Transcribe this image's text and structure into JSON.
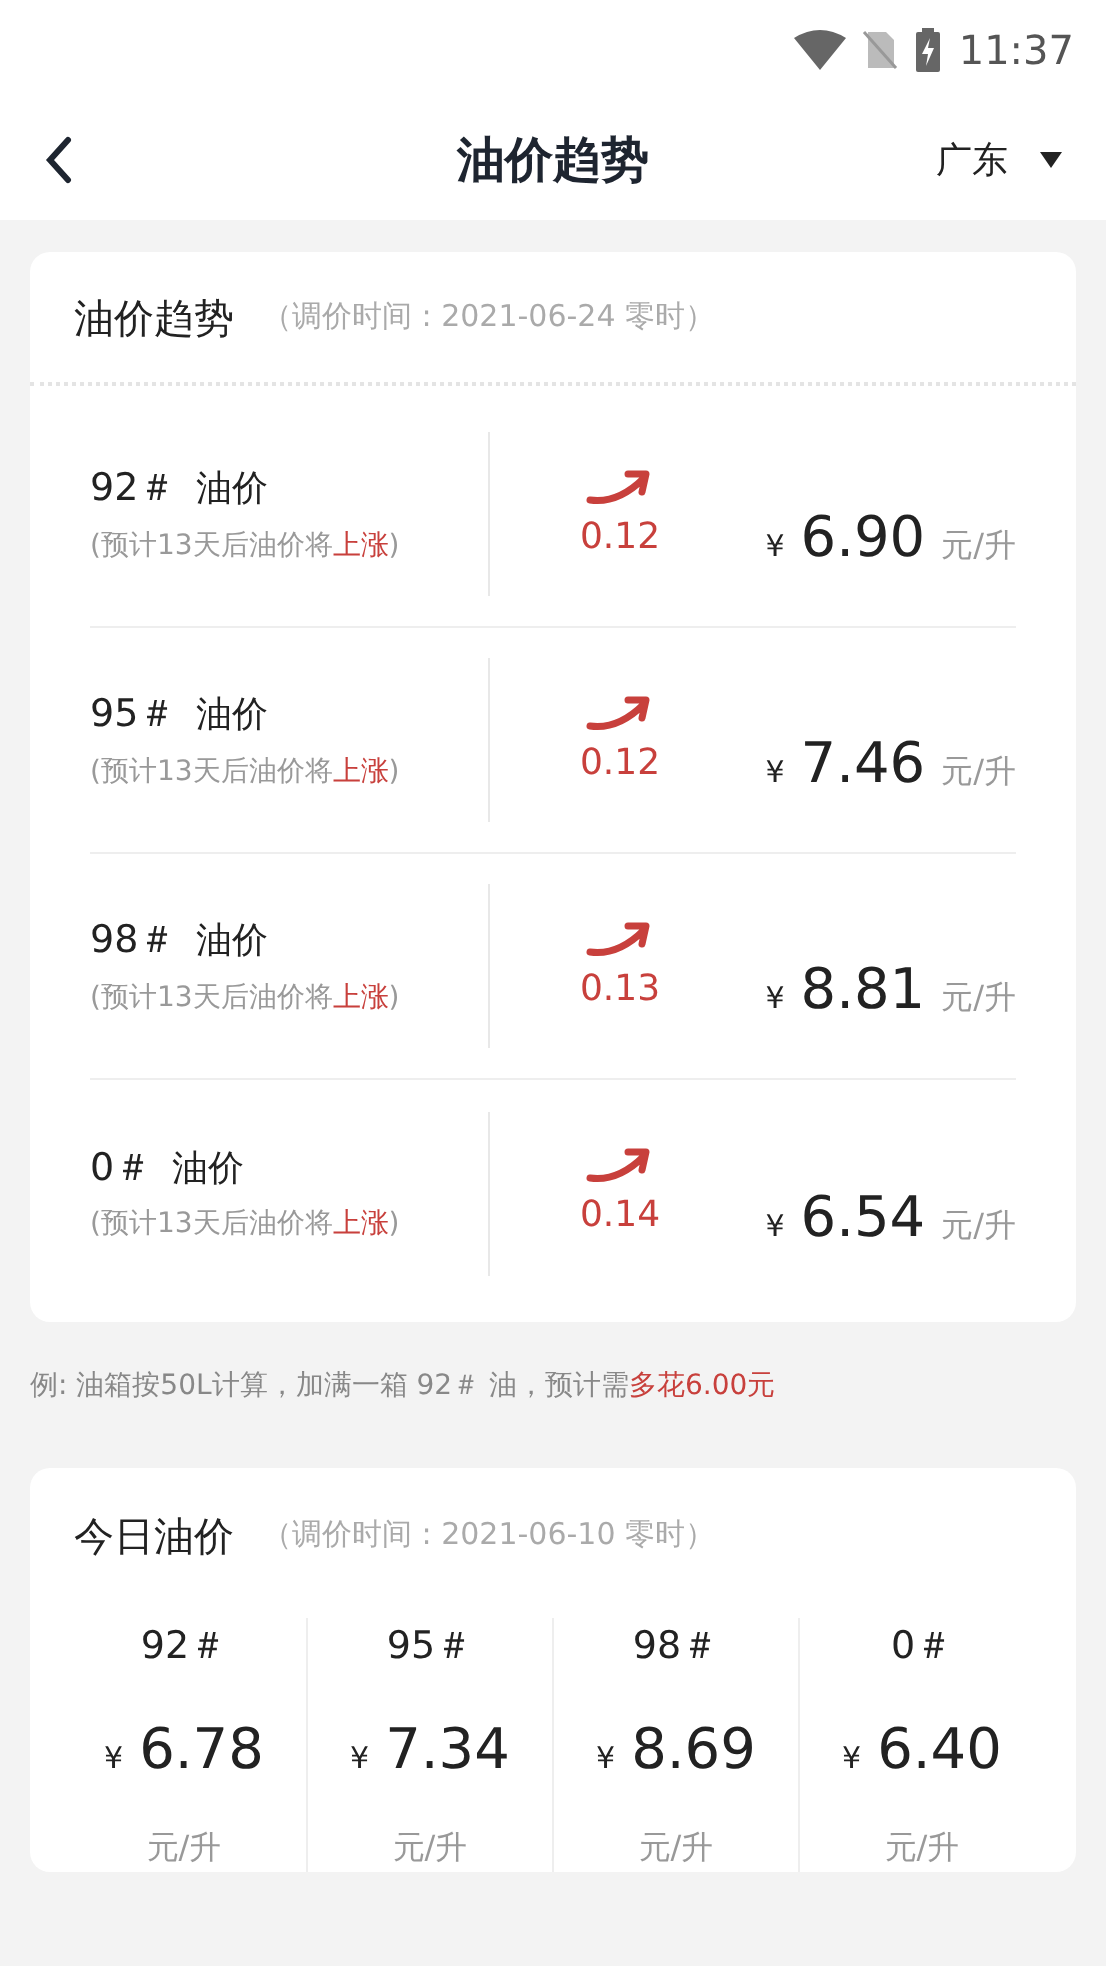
{
  "status_bar": {
    "time": "11:37"
  },
  "header": {
    "title": "油价趋势",
    "region": "广东"
  },
  "trend_card": {
    "title": "油价趋势",
    "adjust_time": "（调价时间 : 2021-06-24 零时）",
    "items": [
      {
        "grade": "92＃",
        "label": "油价",
        "forecast": "(预计13天后油价将**上涨**)",
        "kind": "rise",
        "change": "0.12",
        "currency": "¥",
        "price": "6.90",
        "unit": "元/升"
      },
      {
        "grade": "95＃",
        "label": "油价",
        "forecast": "(预计13天后油价将**上涨**)",
        "kind": "rise",
        "change": "0.12",
        "currency": "¥",
        "price": "7.46",
        "unit": "元/升"
      },
      {
        "grade": "98＃",
        "label": "油价",
        "forecast": "(预计13天后油价将**上涨**)",
        "kind": "rise",
        "change": "0.13",
        "currency": "¥",
        "price": "8.81",
        "unit": "元/升"
      },
      {
        "grade": "0＃",
        "label": "油价",
        "forecast": "(预计13天后油价将**上涨**)",
        "kind": "rise",
        "change": "0.14",
        "currency": "¥",
        "price": "6.54",
        "unit": "元/升"
      }
    ]
  },
  "note": "例: 油箱按50L计算，加满一箱 92＃ 油，预计需**多花6.00元**",
  "today_card": {
    "title": "今日油价",
    "adjust_time": "（调价时间 : 2021-06-10 零时）",
    "items": [
      {
        "grade": "92＃",
        "currency": "¥",
        "price": "6.78",
        "unit": "元/升"
      },
      {
        "grade": "95＃",
        "currency": "¥",
        "price": "7.34",
        "unit": "元/升"
      },
      {
        "grade": "98＃",
        "currency": "¥",
        "price": "8.69",
        "unit": "元/升"
      },
      {
        "grade": "0＃",
        "currency": "¥",
        "price": "6.40",
        "unit": "元/升"
      }
    ]
  }
}
